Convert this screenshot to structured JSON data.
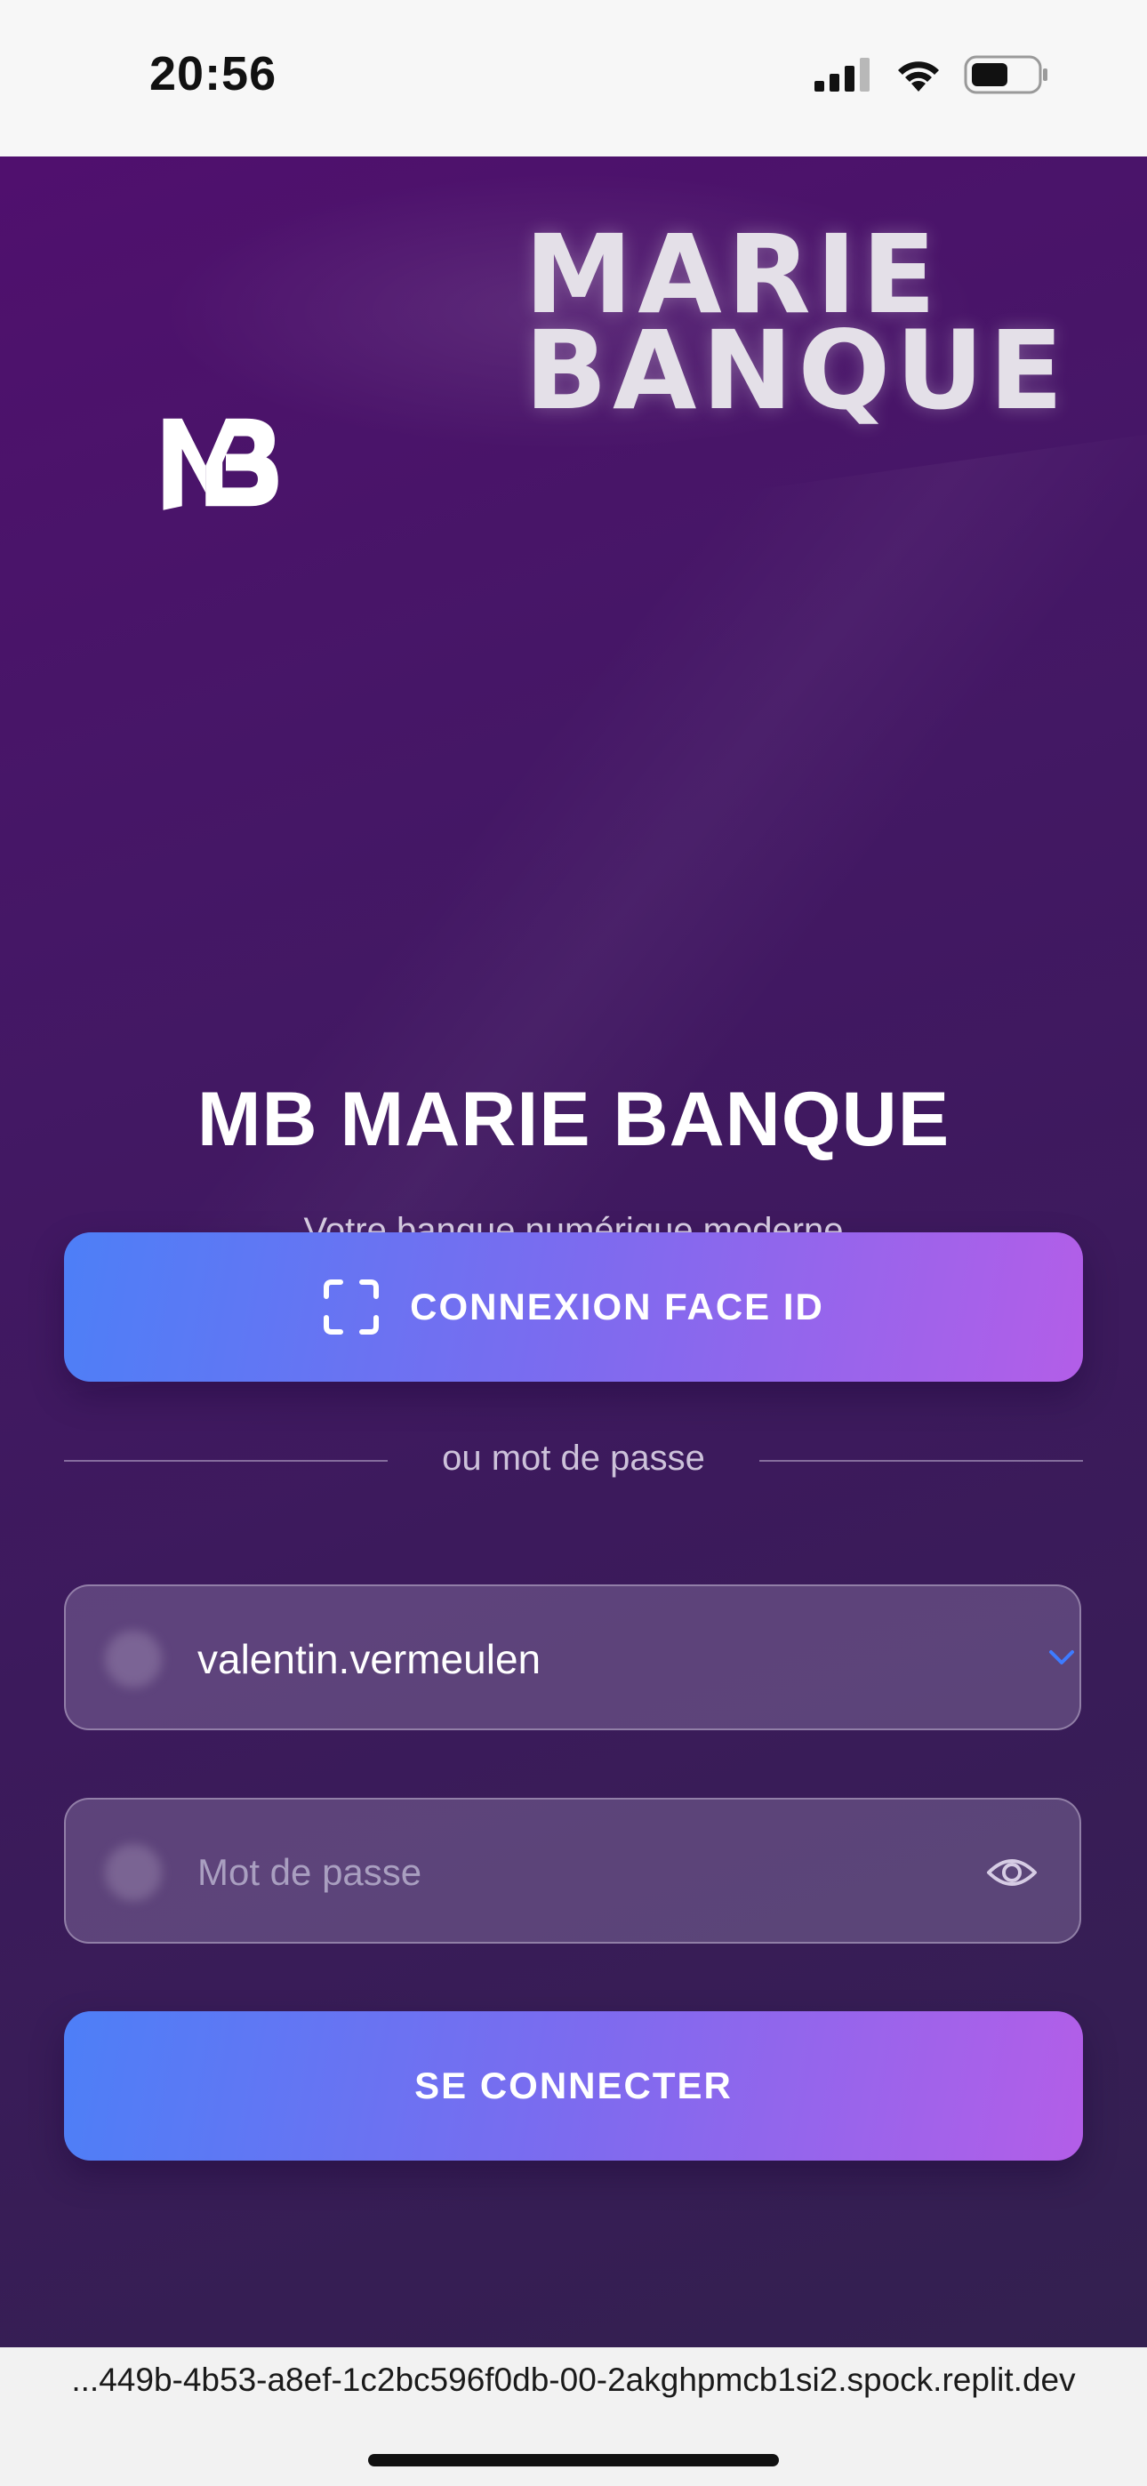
{
  "status_bar": {
    "time": "20:56",
    "icons": [
      "cellular-signal-icon",
      "wifi-icon",
      "battery-icon"
    ]
  },
  "brand": {
    "logo_line1": "MARIE",
    "logo_line2": "BANQUE",
    "logo_monogram": "MB"
  },
  "login": {
    "title": "MB MARIE BANQUE",
    "subtitle": "Votre banque numérique moderne",
    "faceid_label": "CONNEXION FACE ID",
    "divider_label": "ou mot de passe",
    "username_value": "valentin.vermeulen",
    "password_placeholder": "Mot de passe",
    "submit_label": "SE CONNECTER"
  },
  "browser": {
    "url": "...449b-4b53-a8ef-1c2bc596f0db-00-2akghpmcb1si2.spock.replit.dev"
  },
  "colors": {
    "background_top": "#50106e",
    "background_bottom": "#332050",
    "button_gradient_start": "#4d7ff7",
    "button_gradient_end": "#b35ee8"
  }
}
